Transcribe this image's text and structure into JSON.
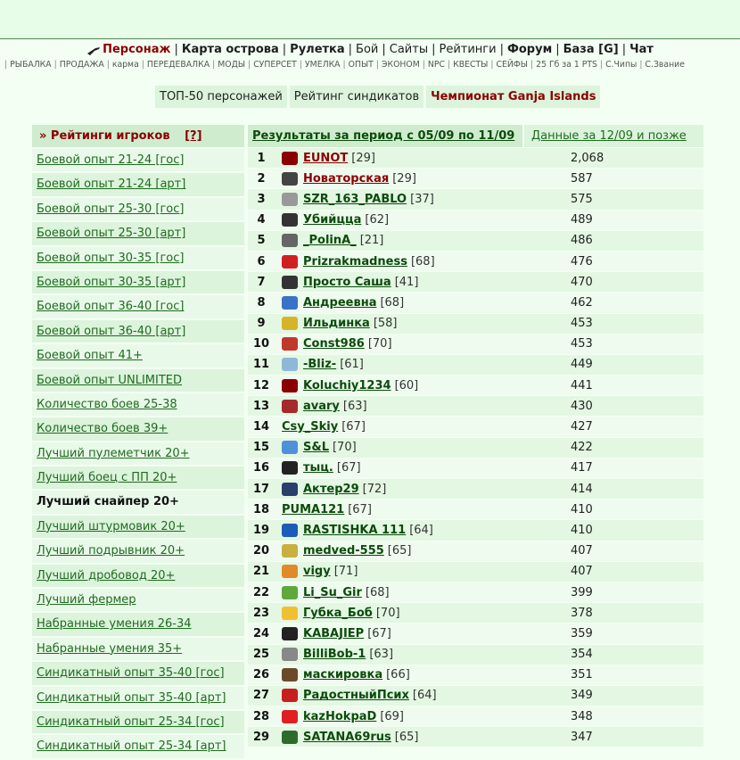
{
  "nav": {
    "primary": [
      {
        "label": "Персонаж",
        "active": true
      },
      {
        "label": "Карта острова"
      },
      {
        "label": "Рулетка"
      },
      {
        "label": "Бой",
        "light": true
      },
      {
        "label": "Сайты",
        "light": true
      },
      {
        "label": "Рейтинги",
        "light": true
      },
      {
        "label": "Форум"
      },
      {
        "label": "База [G]"
      },
      {
        "label": "Чат"
      }
    ],
    "secondary": [
      "РЫБАЛКА",
      "ПРОДАЖА",
      "карма",
      "ПЕРЕДЕВАЛКА",
      "МОДЫ",
      "СУПЕРСЕТ",
      "УМЕЛКА",
      "ОПЫТ",
      "ЭКОНОМ",
      "NPC",
      "КВЕСТЫ",
      "СЕЙФЫ",
      "25 Гб за 1 PTS",
      "С.Чипы",
      "С.Звание"
    ]
  },
  "tabs": [
    {
      "label": "ТОП-50 персонажей"
    },
    {
      "label": "Рейтинг синдикатов"
    },
    {
      "label": "Чемпионат Ganja Islands",
      "active": true
    }
  ],
  "sidebar": {
    "title": "» Рейтинги игроков",
    "help": "[?]",
    "items": [
      "Боевой опыт 21-24 [гос]",
      "Боевой опыт 21-24 [арт]",
      "Боевой опыт 25-30 [гос]",
      "Боевой опыт 25-30 [арт]",
      "Боевой опыт 30-35 [гос]",
      "Боевой опыт 30-35 [арт]",
      "Боевой опыт 36-40 [гос]",
      "Боевой опыт 36-40 [арт]",
      "Боевой опыт 41+",
      "Боевой опыт UNLIMITED",
      "Количество боев 25-38",
      "Количество боев 39+",
      "Лучший пулеметчик 20+",
      "Лучший боец с ПП 20+",
      "Лучший снайпер 20+",
      "Лучший штурмовик 20+",
      "Лучший подрывник 20+",
      "Лучший дробовод 20+",
      "Лучший фермер",
      "Набранные умения 26-34",
      "Набранные умения 35+",
      "Синдикатный опыт 35-40 [гос]",
      "Синдикатный опыт 35-40 [арт]",
      "Синдикатный опыт 25-34 [гос]",
      "Синдикатный опыт 25-34 [арт]"
    ],
    "active_index": 14
  },
  "main": {
    "header_results": "Результаты за период с 05/09 по 11/09",
    "header_next": "Данные за 12/09 и позже",
    "rows": [
      {
        "rank": "1",
        "name": "EUNOT",
        "level": "[29]",
        "value": "2,068",
        "icon": "#8b0000",
        "red": true
      },
      {
        "rank": "2",
        "name": "Новаторская",
        "level": "[29]",
        "value": "587",
        "icon": "#444",
        "red": true
      },
      {
        "rank": "3",
        "name": "SZR_163_PABLO",
        "level": "[37]",
        "value": "575",
        "icon": "#999"
      },
      {
        "rank": "4",
        "name": "Убийцца",
        "level": "[62]",
        "value": "489",
        "icon": "#333"
      },
      {
        "rank": "5",
        "name": "_PolinA_",
        "level": "[21]",
        "value": "486",
        "icon": "#666"
      },
      {
        "rank": "6",
        "name": "Prizrakmadness",
        "level": "[68]",
        "value": "476",
        "icon": "#d02020"
      },
      {
        "rank": "7",
        "name": "Просто Саша",
        "level": "[41]",
        "value": "470",
        "icon": "#333"
      },
      {
        "rank": "8",
        "name": "Андреевна",
        "level": "[68]",
        "value": "462",
        "icon": "#3a72c8"
      },
      {
        "rank": "9",
        "name": "Ильдинка",
        "level": "[58]",
        "value": "453",
        "icon": "#d6b42a"
      },
      {
        "rank": "10",
        "name": "Const986",
        "level": "[70]",
        "value": "453",
        "icon": "#c0392b"
      },
      {
        "rank": "11",
        "name": "-Bliz-",
        "level": "[61]",
        "value": "449",
        "icon": "#8fb8d8"
      },
      {
        "rank": "12",
        "name": "Koluchiy1234",
        "level": "[60]",
        "value": "441",
        "icon": "#8b0000"
      },
      {
        "rank": "13",
        "name": "avary",
        "level": "[63]",
        "value": "430",
        "icon": "#a52a2a"
      },
      {
        "rank": "14",
        "name": "Csy_Skiy",
        "level": "[67]",
        "value": "427",
        "icon": ""
      },
      {
        "rank": "15",
        "name": "S&L",
        "level": "[70]",
        "value": "422",
        "icon": "#4f90d8"
      },
      {
        "rank": "16",
        "name": "тыц.",
        "level": "[67]",
        "value": "417",
        "icon": "#222"
      },
      {
        "rank": "17",
        "name": "Актер29",
        "level": "[72]",
        "value": "414",
        "icon": "#2a3f6b"
      },
      {
        "rank": "18",
        "name": "PUMA121",
        "level": "[67]",
        "value": "410",
        "icon": ""
      },
      {
        "rank": "19",
        "name": "RASTISHKA 111",
        "level": "[64]",
        "value": "410",
        "icon": "#1c5bb8"
      },
      {
        "rank": "20",
        "name": "medved-555",
        "level": "[65]",
        "value": "407",
        "icon": "#c8b040"
      },
      {
        "rank": "21",
        "name": "vigy",
        "level": "[71]",
        "value": "407",
        "icon": "#e08a2a"
      },
      {
        "rank": "22",
        "name": "Li_Su_Gir",
        "level": "[68]",
        "value": "399",
        "icon": "#5fa83c"
      },
      {
        "rank": "23",
        "name": "Губка_Боб",
        "level": "[70]",
        "value": "378",
        "icon": "#f0c030"
      },
      {
        "rank": "24",
        "name": "KABAJIEP",
        "level": "[67]",
        "value": "359",
        "icon": "#222"
      },
      {
        "rank": "25",
        "name": "BilliBob-1",
        "level": "[63]",
        "value": "354",
        "icon": "#888"
      },
      {
        "rank": "26",
        "name": "маскировка",
        "level": "[66]",
        "value": "351",
        "icon": "#6b4a2a"
      },
      {
        "rank": "27",
        "name": "РадостныйПсих",
        "level": "[64]",
        "value": "349",
        "icon": "#c81e1e"
      },
      {
        "rank": "28",
        "name": "kazHokpaD",
        "level": "[69]",
        "value": "348",
        "icon": "#e02020"
      },
      {
        "rank": "29",
        "name": "SATANA69rus",
        "level": "[65]",
        "value": "347",
        "icon": "#2d6b2d"
      }
    ]
  }
}
